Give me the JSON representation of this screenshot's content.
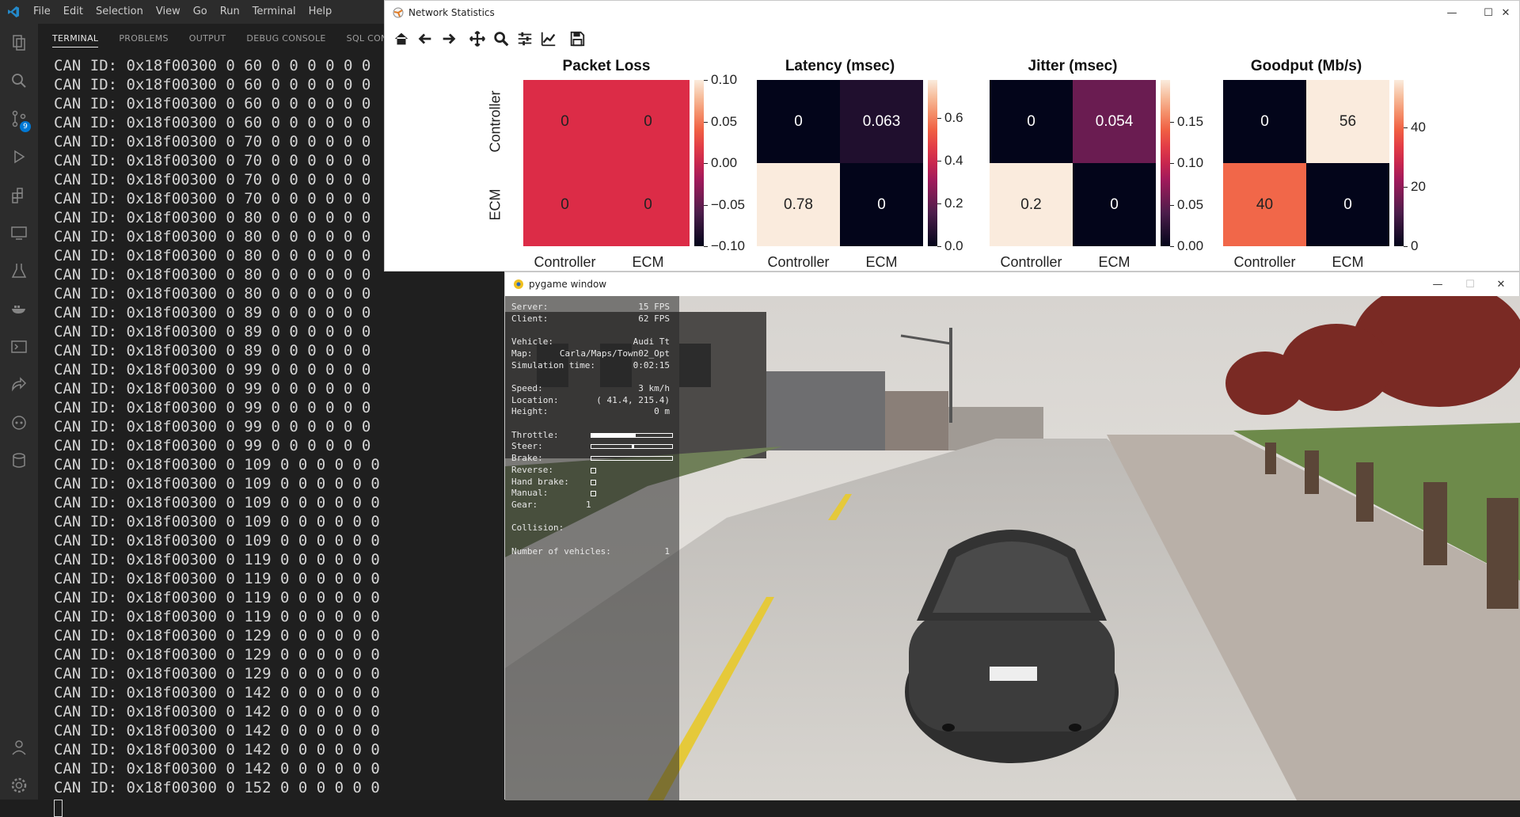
{
  "menubar": {
    "items": [
      "File",
      "Edit",
      "Selection",
      "View",
      "Go",
      "Run",
      "Terminal",
      "Help"
    ]
  },
  "activitybar": {
    "icons": [
      "explorer-icon",
      "search-icon",
      "source-control-icon",
      "run-debug-icon",
      "extensions-icon",
      "remote-explorer-icon",
      "testing-icon",
      "docker-icon",
      "terminal-icon",
      "live-share-icon",
      "copilot-icon",
      "database-icon"
    ],
    "source_control_badge": "9",
    "bottom_icons": [
      "account-icon",
      "settings-icon"
    ]
  },
  "panel": {
    "tabs": [
      "TERMINAL",
      "PROBLEMS",
      "OUTPUT",
      "DEBUG CONSOLE",
      "SQL CONSOLE"
    ],
    "active_tab": "TERMINAL",
    "lines": [
      "CAN ID: 0x18f00300 0 60 0 0 0 0 0 0",
      "CAN ID: 0x18f00300 0 60 0 0 0 0 0 0",
      "CAN ID: 0x18f00300 0 60 0 0 0 0 0 0",
      "CAN ID: 0x18f00300 0 60 0 0 0 0 0 0",
      "CAN ID: 0x18f00300 0 70 0 0 0 0 0 0",
      "CAN ID: 0x18f00300 0 70 0 0 0 0 0 0",
      "CAN ID: 0x18f00300 0 70 0 0 0 0 0 0",
      "CAN ID: 0x18f00300 0 70 0 0 0 0 0 0",
      "CAN ID: 0x18f00300 0 80 0 0 0 0 0 0",
      "CAN ID: 0x18f00300 0 80 0 0 0 0 0 0",
      "CAN ID: 0x18f00300 0 80 0 0 0 0 0 0",
      "CAN ID: 0x18f00300 0 80 0 0 0 0 0 0",
      "CAN ID: 0x18f00300 0 80 0 0 0 0 0 0",
      "CAN ID: 0x18f00300 0 89 0 0 0 0 0 0",
      "CAN ID: 0x18f00300 0 89 0 0 0 0 0 0",
      "CAN ID: 0x18f00300 0 89 0 0 0 0 0 0",
      "CAN ID: 0x18f00300 0 99 0 0 0 0 0 0",
      "CAN ID: 0x18f00300 0 99 0 0 0 0 0 0",
      "CAN ID: 0x18f00300 0 99 0 0 0 0 0 0",
      "CAN ID: 0x18f00300 0 99 0 0 0 0 0 0",
      "CAN ID: 0x18f00300 0 99 0 0 0 0 0 0",
      "CAN ID: 0x18f00300 0 109 0 0 0 0 0 0",
      "CAN ID: 0x18f00300 0 109 0 0 0 0 0 0",
      "CAN ID: 0x18f00300 0 109 0 0 0 0 0 0",
      "CAN ID: 0x18f00300 0 109 0 0 0 0 0 0",
      "CAN ID: 0x18f00300 0 109 0 0 0 0 0 0",
      "CAN ID: 0x18f00300 0 119 0 0 0 0 0 0",
      "CAN ID: 0x18f00300 0 119 0 0 0 0 0 0",
      "CAN ID: 0x18f00300 0 119 0 0 0 0 0 0",
      "CAN ID: 0x18f00300 0 119 0 0 0 0 0 0",
      "CAN ID: 0x18f00300 0 129 0 0 0 0 0 0",
      "CAN ID: 0x18f00300 0 129 0 0 0 0 0 0",
      "CAN ID: 0x18f00300 0 129 0 0 0 0 0 0",
      "CAN ID: 0x18f00300 0 142 0 0 0 0 0 0",
      "CAN ID: 0x18f00300 0 142 0 0 0 0 0 0",
      "CAN ID: 0x18f00300 0 142 0 0 0 0 0 0",
      "CAN ID: 0x18f00300 0 142 0 0 0 0 0 0",
      "CAN ID: 0x18f00300 0 142 0 0 0 0 0 0",
      "CAN ID: 0x18f00300 0 152 0 0 0 0 0 0"
    ]
  },
  "netwin": {
    "title": "Network Statistics",
    "toolbar": [
      "home-icon",
      "back-icon",
      "forward-icon",
      "pan-icon",
      "zoom-icon",
      "configure-subplots-icon",
      "edit-axis-icon",
      "save-icon"
    ]
  },
  "chart_data": [
    {
      "type": "heatmap",
      "title": "Packet Loss",
      "rows": [
        "Controller",
        "ECM"
      ],
      "cols": [
        "Controller",
        "ECM"
      ],
      "values": [
        [
          0,
          0
        ],
        [
          0,
          0
        ]
      ],
      "labels": [
        [
          "0",
          "0"
        ],
        [
          "0",
          "0"
        ]
      ],
      "colorbar_ticks": [
        "0.10",
        "0.05",
        "0.00",
        "−0.05",
        "−0.10"
      ],
      "colorbar_range": [
        -0.1,
        0.1
      ],
      "colormap": "rocket"
    },
    {
      "type": "heatmap",
      "title": "Latency (msec)",
      "rows": [
        "Controller",
        "ECM"
      ],
      "cols": [
        "Controller",
        "ECM"
      ],
      "values": [
        [
          0,
          0.063
        ],
        [
          0.78,
          0
        ]
      ],
      "labels": [
        [
          "0",
          "0.063"
        ],
        [
          "0.78",
          "0"
        ]
      ],
      "colorbar_ticks": [
        "0.6",
        "0.4",
        "0.2",
        "0.0"
      ],
      "colorbar_range": [
        0,
        0.78
      ],
      "colormap": "rocket"
    },
    {
      "type": "heatmap",
      "title": "Jitter (msec)",
      "rows": [
        "Controller",
        "ECM"
      ],
      "cols": [
        "Controller",
        "ECM"
      ],
      "values": [
        [
          0,
          0.054
        ],
        [
          0.2,
          0
        ]
      ],
      "labels": [
        [
          "0",
          "0.054"
        ],
        [
          "0.2",
          "0"
        ]
      ],
      "colorbar_ticks": [
        "0.15",
        "0.10",
        "0.05",
        "0.00"
      ],
      "colorbar_range": [
        0,
        0.2
      ],
      "colormap": "rocket"
    },
    {
      "type": "heatmap",
      "title": "Goodput (Mb/s)",
      "rows": [
        "Controller",
        "ECM"
      ],
      "cols": [
        "Controller",
        "ECM"
      ],
      "values": [
        [
          0,
          56
        ],
        [
          40,
          0
        ]
      ],
      "labels": [
        [
          "0",
          "56"
        ],
        [
          "40",
          "0"
        ]
      ],
      "colorbar_ticks": [
        "40",
        "20",
        "0"
      ],
      "colorbar_range": [
        0,
        56
      ],
      "colormap": "rocket"
    }
  ],
  "pywin": {
    "title": "pygame window",
    "hud": [
      {
        "k": "Server:",
        "v": "15 FPS"
      },
      {
        "k": "Client:",
        "v": "62 FPS"
      },
      {
        "k": "",
        "v": ""
      },
      {
        "k": "Vehicle:",
        "v": "Audi Tt"
      },
      {
        "k": "Map:",
        "v": "Carla/Maps/Town02_Opt"
      },
      {
        "k": "Simulation time:",
        "v": "0:02:15"
      },
      {
        "k": "",
        "v": ""
      },
      {
        "k": "Speed:",
        "v": "3 km/h"
      },
      {
        "k": "Location:",
        "v": "( 41.4,  215.4)"
      },
      {
        "k": "Height:",
        "v": "0 m"
      },
      {
        "k": "",
        "v": ""
      },
      {
        "k": "Throttle:",
        "bar": 0.55
      },
      {
        "k": "Steer:",
        "bar": 0.5
      },
      {
        "k": "Brake:",
        "bar": 0
      },
      {
        "k": "Reverse:",
        "box": true
      },
      {
        "k": "Hand brake:",
        "box": true
      },
      {
        "k": "Manual:",
        "box": true
      },
      {
        "k": "Gear:",
        "v": "1",
        "vleft": true
      },
      {
        "k": "",
        "v": ""
      },
      {
        "k": "Collision:",
        "v": ""
      },
      {
        "k": "",
        "v": ""
      },
      {
        "k": "Number of vehicles:",
        "v": "1"
      }
    ]
  },
  "colors": {
    "vscode_bg": "#1e1e1e",
    "accent": "#0078d4"
  }
}
